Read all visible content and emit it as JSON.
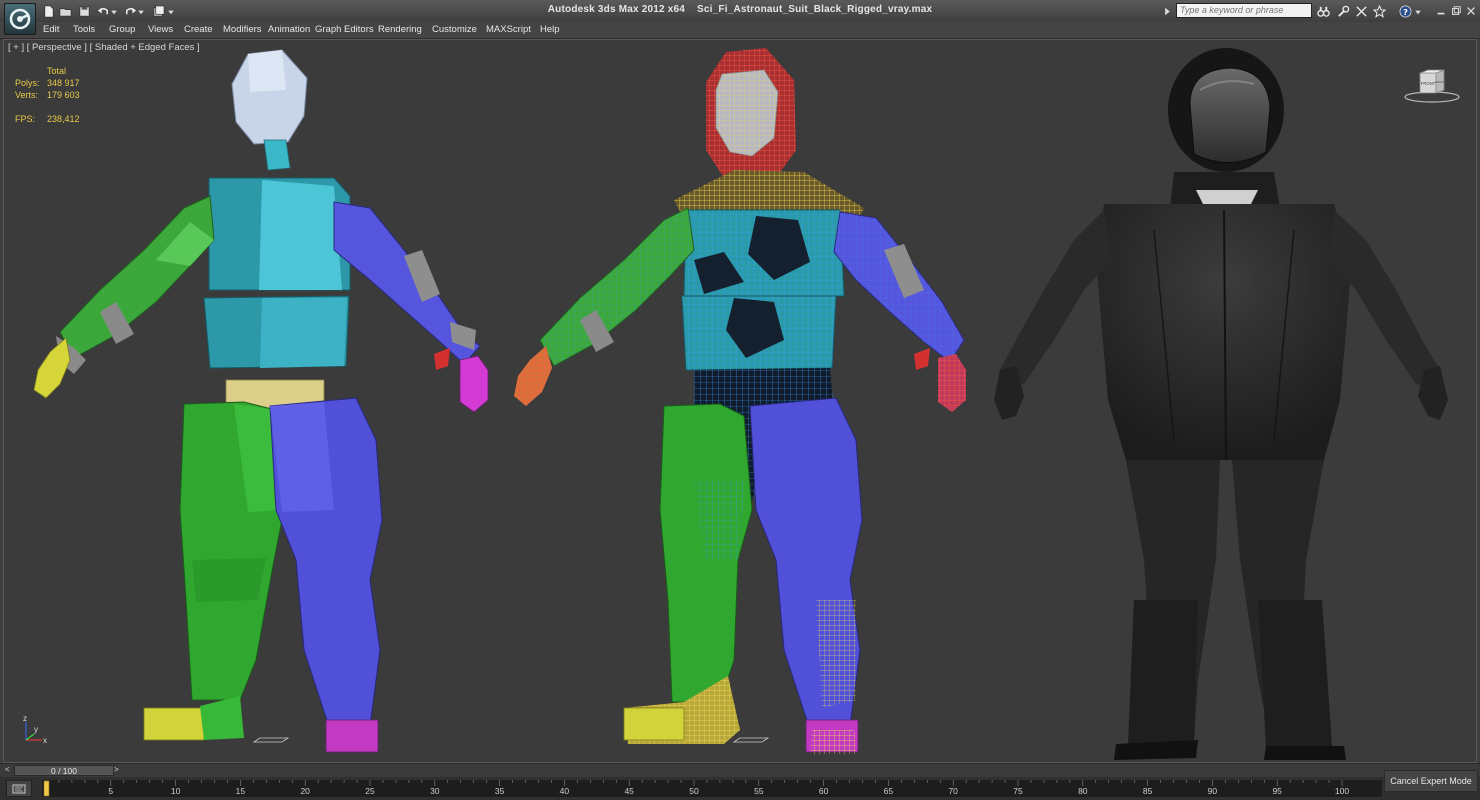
{
  "window": {
    "app_name": "Autodesk 3ds Max  2012 x64",
    "file_name": "Sci_Fi_Astronaut_Suit_Black_Rigged_vray.max"
  },
  "search": {
    "placeholder": "Type a keyword or phrase"
  },
  "menu": [
    "Edit",
    "Tools",
    "Group",
    "Views",
    "Create",
    "Modifiers",
    "Animation",
    "Graph Editors",
    "Rendering",
    "Customize",
    "MAXScript",
    "Help"
  ],
  "viewport": {
    "label": "[ + ] [ Perspective ] [ Shaded + Edged Faces ]",
    "stats": {
      "header": "Total",
      "polys_label": "Polys:",
      "polys_value": "348 917",
      "verts_label": "Verts:",
      "verts_value": "179 603",
      "fps_label": "FPS:",
      "fps_value": "238,412"
    },
    "viewcube": {
      "front": "FRONT",
      "right": "RIGHT"
    },
    "axis": {
      "z": "z",
      "x": "x",
      "y": "y"
    }
  },
  "timeline": {
    "frame_text": "0 / 100",
    "prev": "<",
    "next": ">",
    "ticks": [
      "0",
      "5",
      "10",
      "15",
      "20",
      "25",
      "30",
      "35",
      "40",
      "45",
      "50",
      "55",
      "60",
      "65",
      "70",
      "75",
      "80",
      "85",
      "90",
      "95",
      "100"
    ]
  },
  "status": {
    "cancel_expert_mode": "Cancel Expert Mode"
  },
  "icons": [
    "app-logo-icon",
    "new-file-icon",
    "open-file-icon",
    "save-icon",
    "undo-icon",
    "redo-icon",
    "project-icon",
    "search-icon",
    "binoculars-icon",
    "wrench-icon",
    "star-icon",
    "help-icon",
    "minimize-icon",
    "restore-icon",
    "close-icon",
    "key-icon"
  ]
}
